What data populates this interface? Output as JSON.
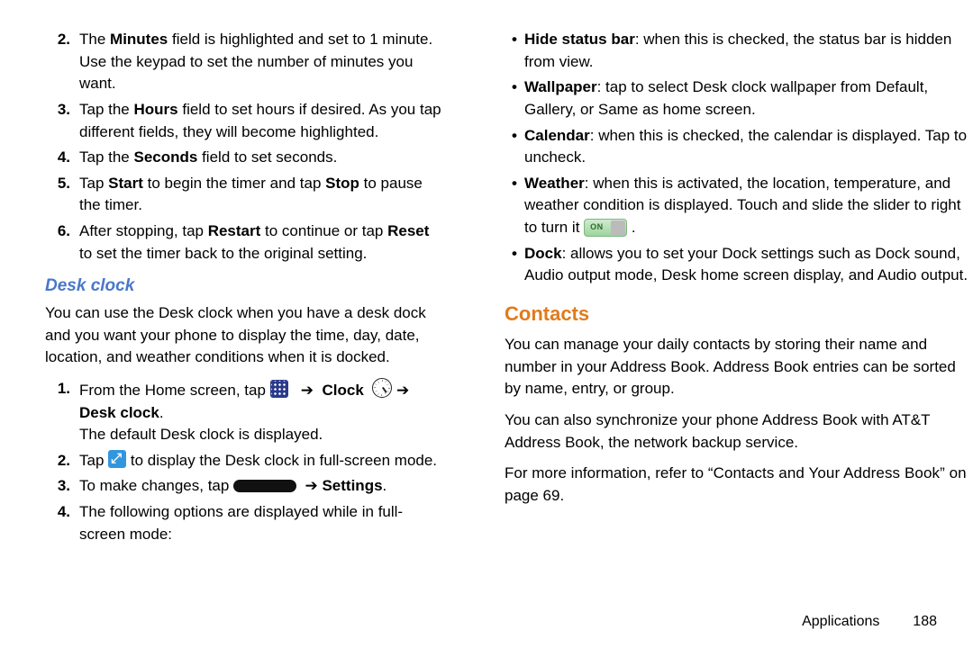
{
  "left": {
    "steps": [
      {
        "n": "2.",
        "html": "The <b>Minutes</b> field is highlighted and set to 1 minute. Use the keypad to set the number of minutes you want."
      },
      {
        "n": "3.",
        "html": "Tap the <b>Hours</b> field to set hours if desired. As you tap different fields, they will become highlighted."
      },
      {
        "n": "4.",
        "html": "Tap the <b>Seconds</b> field to set seconds."
      },
      {
        "n": "5.",
        "html": "Tap <b>Start</b> to begin the timer and tap <b>Stop</b> to pause the timer."
      },
      {
        "n": "6.",
        "html": "After stopping, tap <b>Restart</b> to continue or tap <b>Reset</b> to set the timer back to the original setting."
      }
    ],
    "desk_heading": "Desk clock",
    "desk_intro": "You can use the Desk clock when you have a desk dock and you want your phone to display the time, day, date, location, and weather conditions when it is docked.",
    "desk_steps": {
      "s1_a": "From the Home screen, tap ",
      "s1_clock": "Clock",
      "s1_arrow": " ➔ ",
      "s1_desk": "Desk clock",
      "s1_after": "The default Desk clock is displayed.",
      "s2_a": "Tap ",
      "s2_b": " to display the Desk clock in full-screen mode.",
      "s3_a": "To make changes, tap ",
      "s3_settings": "Settings",
      "s4": "The following options are displayed while in full-screen mode:"
    }
  },
  "right": {
    "bullets": [
      {
        "html": "<b>Hide status bar</b>: when this is checked, the status bar is hidden from view."
      },
      {
        "html": "<b>Wallpaper</b>: tap to select Desk clock wallpaper from Default, Gallery, or Same as home screen."
      },
      {
        "html": "<b>Calendar</b>: when this is checked, the calendar is displayed. Tap to uncheck."
      },
      {
        "weather_a": "<b>Weather</b>: when this is activated, the location, temperature, and weather condition is displayed. Touch and slide the slider to right to turn it ",
        "weather_b": "."
      },
      {
        "html": "<b>Dock</b>: allows you to set your Dock settings such as Dock sound, Audio output mode, Desk home screen display, and Audio output."
      }
    ],
    "contacts_heading": "Contacts",
    "contacts_p1": "You can manage your daily contacts by storing their name and number in your Address Book. Address Book entries can be sorted by name, entry, or group.",
    "contacts_p2": "You can also synchronize your phone Address Book with AT&T Address Book, the network backup service.",
    "contacts_p3_a": "For more information, refer to ",
    "contacts_p3_q": "“Contacts and Your Address Book”",
    "contacts_p3_b": " on page 69."
  },
  "footer": {
    "section": "Applications",
    "page": "188"
  }
}
